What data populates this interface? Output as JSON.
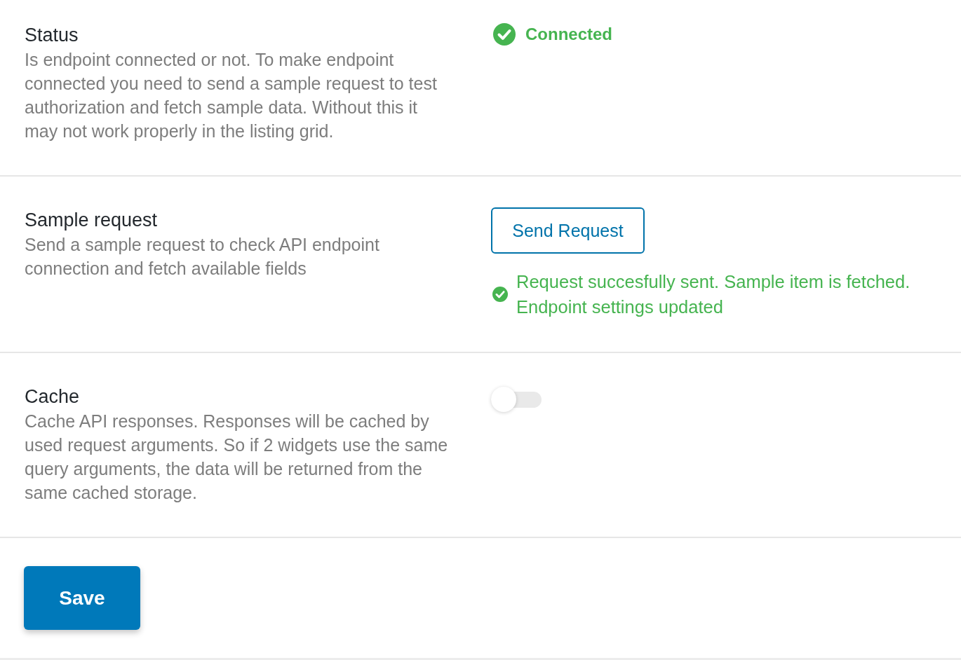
{
  "settings": [
    {
      "kind": "status",
      "title": "Status",
      "description": "Is endpoint connected or not. To make endpoint connected you need to send a sample request to test authorization and fetch sample data. Without this it may not work properly in the listing grid.",
      "status": {
        "label": "Connected",
        "connected": true
      }
    },
    {
      "kind": "action",
      "title": "Sample request",
      "description": "Send a sample request to check API endpoint connection and fetch available fields",
      "button": "Send Request",
      "message": "Request succesfully sent. Sample item is fetched. Endpoint settings updated"
    },
    {
      "kind": "toggle",
      "title": "Cache",
      "description": "Cache API responses. Responses will be cached by used request arguments. So if 2 widgets use the same query arguments, the data will be returned from the same cached storage.",
      "on": false
    }
  ],
  "save_button": "Save"
}
